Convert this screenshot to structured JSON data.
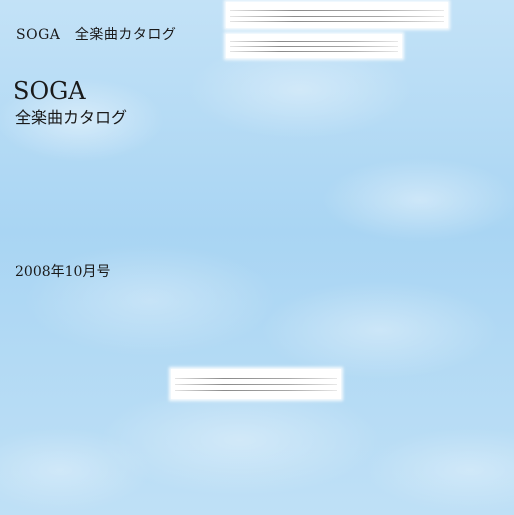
{
  "header": {
    "title": "SOGA　全楽曲カタログ"
  },
  "cover": {
    "main_title": "SOGA",
    "subtitle": "全楽曲カタログ",
    "issue_date": "2008年10月号"
  }
}
